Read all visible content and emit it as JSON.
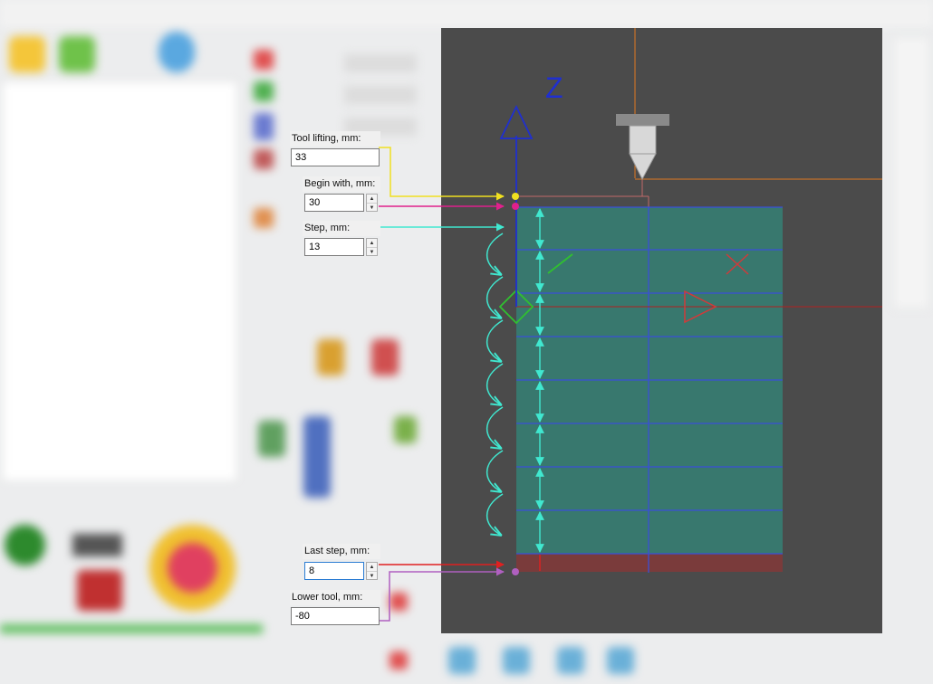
{
  "fields": {
    "tool_lifting": {
      "label": "Tool lifting, mm:",
      "value": "33"
    },
    "begin_with": {
      "label": "Begin with, mm:",
      "value": "30"
    },
    "step": {
      "label": "Step, mm:",
      "value": "13"
    },
    "last_step": {
      "label": "Last step, mm:",
      "value": "8"
    },
    "lower_tool": {
      "label": "Lower tool, mm:",
      "value": "-80"
    }
  },
  "viewport": {
    "axis_label": "Z",
    "colors": {
      "background": "#4b4b4b",
      "material": "#38786e",
      "last_layer": "#7a3b3b",
      "layer_line": "#3a4fd8",
      "z_axis": "#1f2fd0",
      "step_arrow": "#40e8d0",
      "tool_lifting": "#f0e020",
      "begin_with": "#e0208c",
      "last_step": "#e02020",
      "lower_tool": "#b060c0",
      "guide": "#e07a20"
    }
  },
  "icons": {
    "spin_up": "▲",
    "spin_down": "▼"
  }
}
